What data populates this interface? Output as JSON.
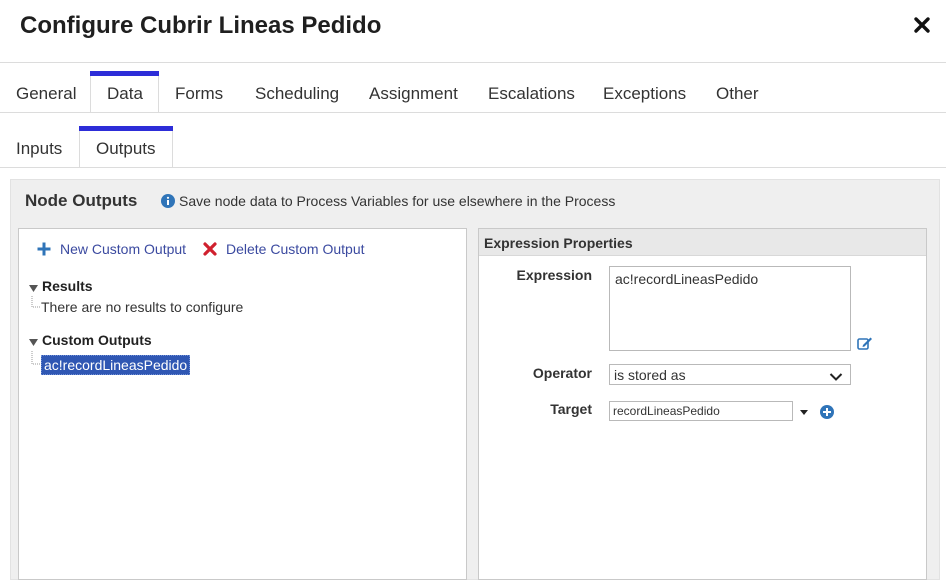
{
  "dialog": {
    "title": "Configure Cubrir Lineas Pedido",
    "close_icon": "close-icon"
  },
  "main_tabs": [
    {
      "label": "General",
      "active": false
    },
    {
      "label": "Data",
      "active": true
    },
    {
      "label": "Forms",
      "active": false
    },
    {
      "label": "Scheduling",
      "active": false
    },
    {
      "label": "Assignment",
      "active": false
    },
    {
      "label": "Escalations",
      "active": false
    },
    {
      "label": "Exceptions",
      "active": false
    },
    {
      "label": "Other",
      "active": false
    }
  ],
  "sub_tabs": [
    {
      "label": "Inputs",
      "active": false
    },
    {
      "label": "Outputs",
      "active": true
    }
  ],
  "panel": {
    "title": "Node Outputs",
    "info_icon": "info-icon",
    "info_text": "Save node data to Process Variables for use elsewhere in the Process"
  },
  "left": {
    "new_label": "New Custom Output",
    "delete_label": "Delete Custom Output",
    "results_label": "Results",
    "results_empty": "There are no results to configure",
    "custom_outputs_label": "Custom Outputs",
    "custom_outputs": [
      "ac!recordLineasPedido"
    ]
  },
  "right": {
    "header": "Expression Properties",
    "expression_label": "Expression",
    "expression_value": "ac!recordLineasPedido",
    "operator_label": "Operator",
    "operator_value": "is stored as",
    "target_label": "Target",
    "target_value": "recordLineasPedido"
  },
  "colors": {
    "accent": "#2d2dd8",
    "link": "#3b4aa0",
    "selection": "#2f57b3",
    "delete_red": "#d0202e",
    "add_blue": "#2f74b8"
  }
}
